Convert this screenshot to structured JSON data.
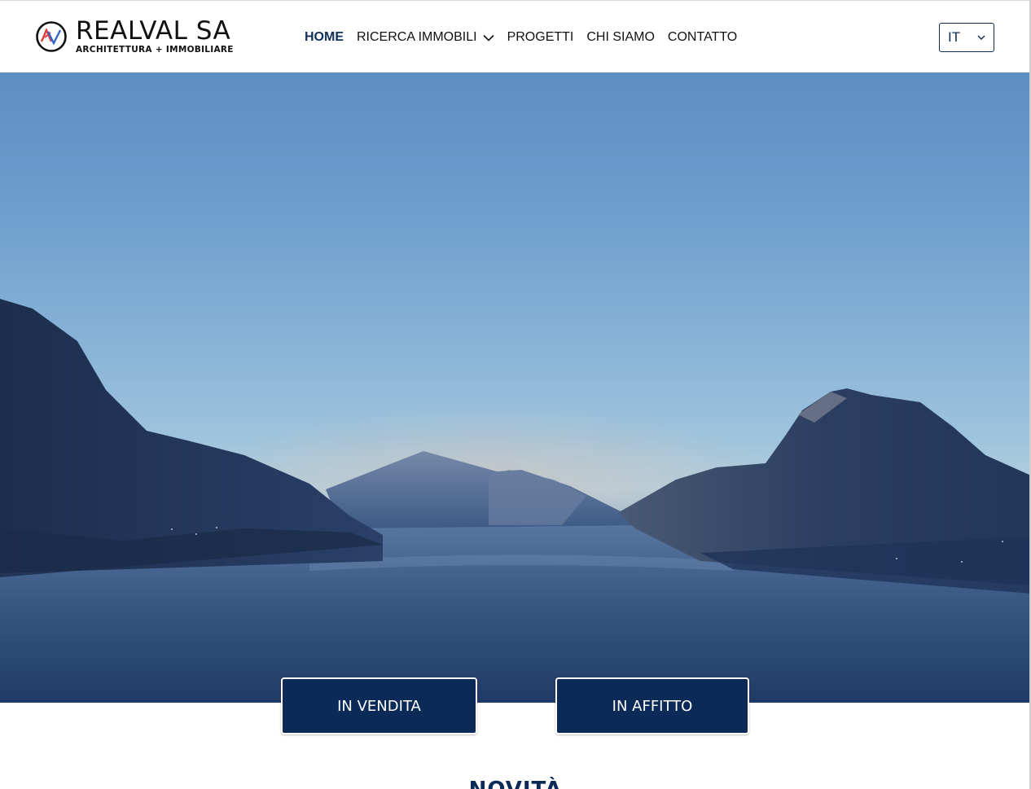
{
  "brand": {
    "name": "REALVAL SA",
    "tagline": "ARCHITETTURA + IMMOBILIARE",
    "logo_icon": "rv-monogram-circle",
    "colors": {
      "red": "#e63b3b",
      "blue": "#2f67c9",
      "dark": "#111111"
    }
  },
  "nav": {
    "items": [
      {
        "label": "HOME",
        "active": true
      },
      {
        "label": "RICERCA IMMOBILI",
        "has_dropdown": true
      },
      {
        "label": "PROGETTI"
      },
      {
        "label": "CHI SIAMO"
      },
      {
        "label": "CONTATTO"
      }
    ],
    "active_color": "#102f5c"
  },
  "language": {
    "selected": "IT",
    "icon": "chevron-down-icon"
  },
  "hero": {
    "image": "lake-and-mountains-at-dusk"
  },
  "actions": {
    "sale_label": "IN VENDITA",
    "rent_label": "IN AFFITTO",
    "button_color": "#0b2a57"
  },
  "news": {
    "title": "NOVITÀ"
  }
}
